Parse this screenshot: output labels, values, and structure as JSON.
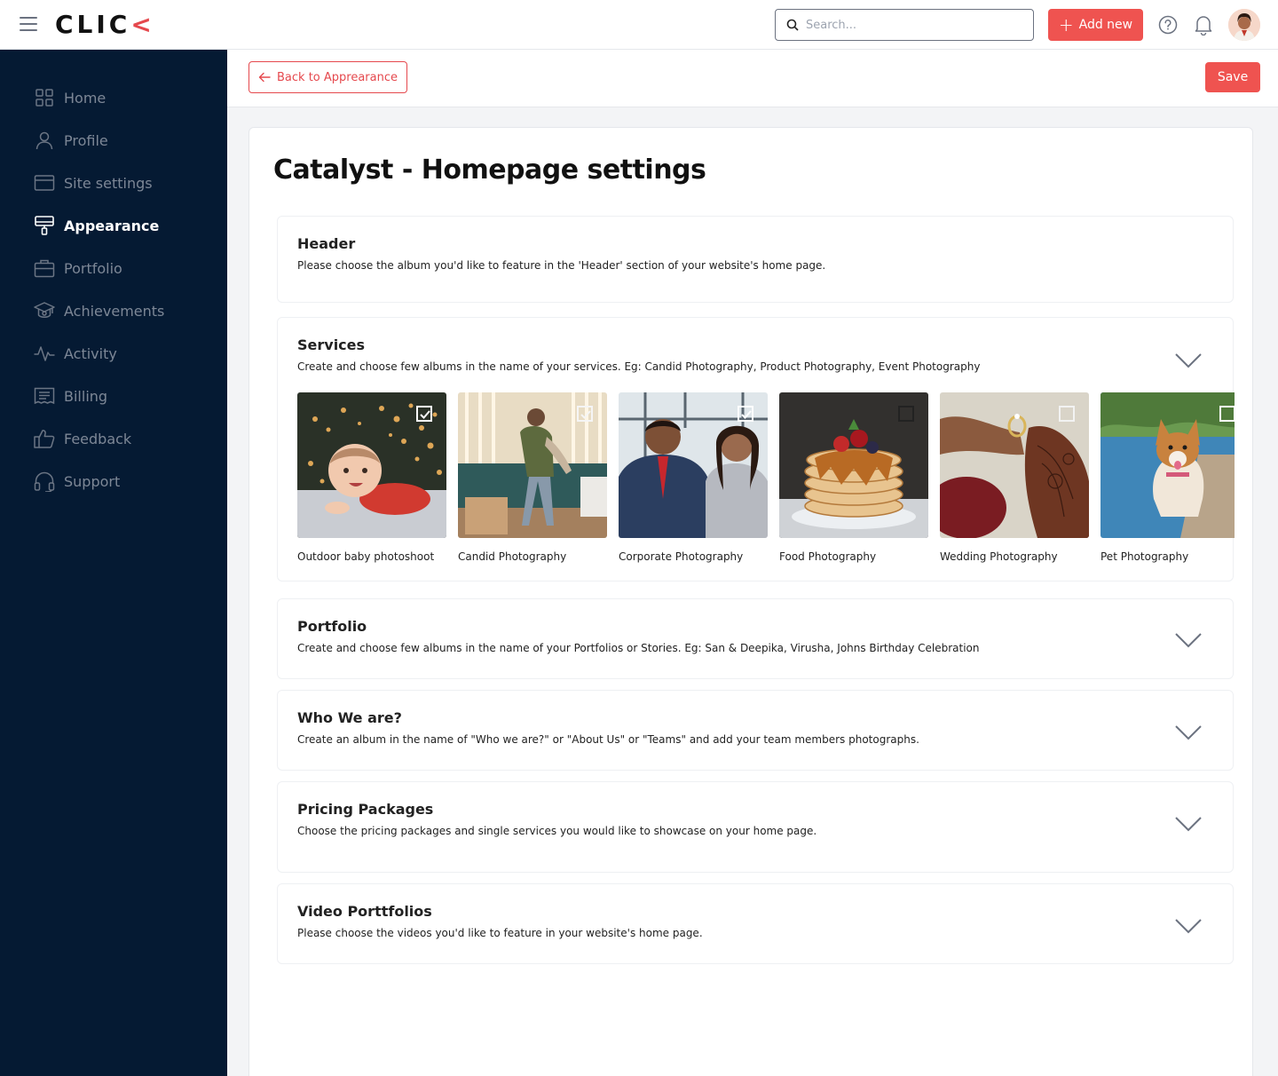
{
  "topbar": {
    "logo_main": "CLIC",
    "logo_accent": "<",
    "search_placeholder": "Search...",
    "add_new_label": "Add new",
    "add_new_icon": "plus-icon",
    "help_icon": "help-circle-icon",
    "bell_icon": "bell-icon",
    "accent_color": "#ef5350"
  },
  "sidebar": {
    "background": "#051a33",
    "items": [
      {
        "label": "Home",
        "icon": "grid-icon",
        "active": false
      },
      {
        "label": "Profile",
        "icon": "user-icon",
        "active": false
      },
      {
        "label": "Site settings",
        "icon": "window-icon",
        "active": false
      },
      {
        "label": "Appearance",
        "icon": "paint-roller-icon",
        "active": true
      },
      {
        "label": "Portfolio",
        "icon": "briefcase-icon",
        "active": false
      },
      {
        "label": "Achievements",
        "icon": "graduation-cap-icon",
        "active": false
      },
      {
        "label": "Activity",
        "icon": "activity-icon",
        "active": false
      },
      {
        "label": "Billing",
        "icon": "receipt-icon",
        "active": false
      },
      {
        "label": "Feedback",
        "icon": "thumbs-up-icon",
        "active": false
      },
      {
        "label": "Support",
        "icon": "headset-icon",
        "active": false
      }
    ]
  },
  "subbar": {
    "back_label": "Back to Apprearance",
    "save_label": "Save"
  },
  "page": {
    "title": "Catalyst - Homepage settings"
  },
  "sections": {
    "header": {
      "title": "Header",
      "description": "Please choose the album you'd like to feature in the 'Header' section of your website's home page."
    },
    "services": {
      "title": "Services",
      "description": "Create and choose few albums in the name of your services. Eg: Candid Photography, Product Photography, Event Photography",
      "albums": [
        {
          "label": "Outdoor baby photoshoot",
          "checked": true
        },
        {
          "label": "Candid Photography",
          "checked": true
        },
        {
          "label": "Corporate Photography",
          "checked": true
        },
        {
          "label": "Food Photography",
          "checked": false
        },
        {
          "label": "Wedding Photography",
          "checked": false
        },
        {
          "label": "Pet Photography",
          "checked": false
        }
      ]
    },
    "portfolio": {
      "title": "Portfolio",
      "description": "Create and choose few albums in the name of your Portfolios or Stories. Eg: San & Deepika, Virusha, Johns Birthday Celebration"
    },
    "who": {
      "title": "Who We are?",
      "description": "Create an album in the name of \"Who we are?\" or \"About Us\" or \"Teams\" and add your team members photographs."
    },
    "pricing": {
      "title": "Pricing Packages",
      "description": "Choose the pricing packages and single services you would like to showcase on your home page."
    },
    "video": {
      "title": "Video Porttfolios",
      "description": "Please choose the videos you'd like to feature in your website's home page."
    }
  }
}
